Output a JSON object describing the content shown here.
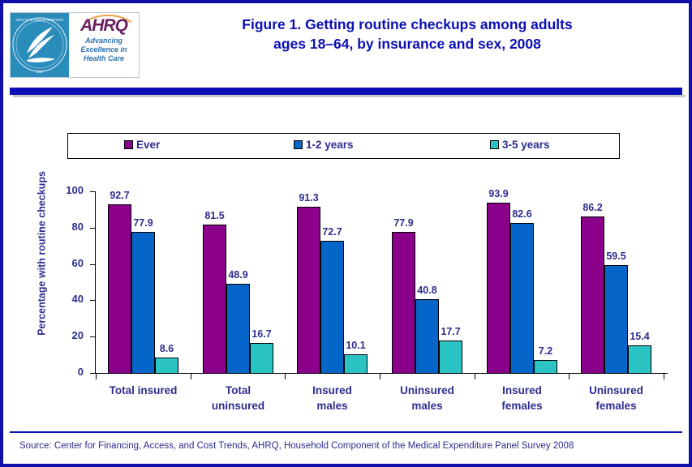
{
  "title": {
    "line1": "Figure 1. Getting routine checkups among adults",
    "line2": "ages 18–64, by insurance and sex, 2008"
  },
  "logo": {
    "seal_alt": "hhs-seal",
    "wordmark": "AHRQ",
    "tagline_line1": "Advancing",
    "tagline_line2": "Excellence in",
    "tagline_line3": "Health Care"
  },
  "source": "Source: Center for Financing, Access, and Cost Trends, AHRQ, Household Component of the Medical Expenditure Panel Survey 2008",
  "colors": {
    "ever": "#8B008B",
    "one_two_years": "#0565C8",
    "three_five_years": "#2BC4C4",
    "text_blue": "#2D2D8F",
    "title_blue": "#0C10B4",
    "border_blue": "#1010A8"
  },
  "chart_data": {
    "type": "bar",
    "title": "Figure 1. Getting routine checkups among adults ages 18–64, by insurance and sex, 2008",
    "xlabel": "",
    "ylabel": "Percentage with routine checkups",
    "ylim": [
      0,
      100
    ],
    "yticks": [
      0,
      20,
      40,
      60,
      80,
      100
    ],
    "grid": false,
    "legend_position": "top",
    "categories": [
      "Total insured",
      "Total uninsured",
      "Insured males",
      "Uninsured males",
      "Insured females",
      "Uninsured females"
    ],
    "category_lines": [
      [
        "Total insured"
      ],
      [
        "Total",
        "uninsured"
      ],
      [
        "Insured",
        "males"
      ],
      [
        "Uninsured",
        "males"
      ],
      [
        "Insured",
        "females"
      ],
      [
        "Uninsured",
        "females"
      ]
    ],
    "series": [
      {
        "name": "Ever",
        "color": "#8B008B",
        "values": [
          92.7,
          81.5,
          91.3,
          77.9,
          93.9,
          86.2
        ]
      },
      {
        "name": "1-2 years",
        "color": "#0565C8",
        "values": [
          77.9,
          48.9,
          72.7,
          40.8,
          82.6,
          59.5
        ]
      },
      {
        "name": "3-5 years",
        "color": "#2BC4C4",
        "values": [
          8.6,
          16.7,
          10.1,
          17.7,
          7.2,
          15.4
        ]
      }
    ]
  }
}
